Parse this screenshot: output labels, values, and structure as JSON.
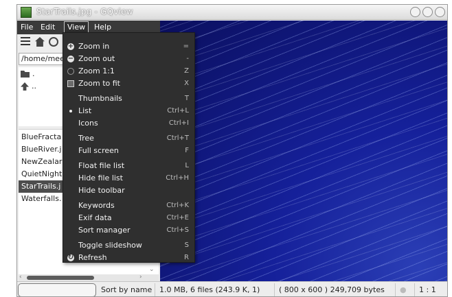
{
  "window": {
    "title": "StarTrails.jpg - GQview"
  },
  "menubar": {
    "file": "File",
    "edit": "Edit",
    "view": "View",
    "help": "Help"
  },
  "sidebar": {
    "path": "/home/mee",
    "dirs": [
      ".",
      ".."
    ],
    "files": [
      "BlueFracta",
      "BlueRiver.j",
      "NewZealar",
      "QuietNight",
      "StarTrails.j",
      "Waterfalls."
    ],
    "selected_index": 4
  },
  "menu": {
    "items": [
      {
        "label": "Zoom in",
        "accel": "=",
        "icon": "zoom-in-icon"
      },
      {
        "label": "Zoom out",
        "accel": "-",
        "icon": "zoom-out-icon"
      },
      {
        "label": "Zoom 1:1",
        "accel": "Z",
        "icon": "zoom-100-icon"
      },
      {
        "label": "Zoom to fit",
        "accel": "X",
        "icon": "zoom-fit-icon"
      },
      {
        "label": "Thumbnails",
        "accel": "T"
      },
      {
        "label": "List",
        "accel": "Ctrl+L",
        "icon": "radio-selected-icon"
      },
      {
        "label": "Icons",
        "accel": "Ctrl+I"
      },
      {
        "label": "Tree",
        "accel": "Ctrl+T"
      },
      {
        "label": "Full screen",
        "accel": "F"
      },
      {
        "label": "Float file list",
        "accel": "L"
      },
      {
        "label": "Hide file list",
        "accel": "Ctrl+H"
      },
      {
        "label": "Hide toolbar",
        "accel": ""
      },
      {
        "label": "Keywords",
        "accel": "Ctrl+K"
      },
      {
        "label": "Exif data",
        "accel": "Ctrl+E"
      },
      {
        "label": "Sort manager",
        "accel": "Ctrl+S"
      },
      {
        "label": "Toggle slideshow",
        "accel": "S"
      },
      {
        "label": "Refresh",
        "accel": "R",
        "icon": "refresh-icon"
      }
    ]
  },
  "status": {
    "sort": "Sort by name",
    "info": "1.0 MB, 6 files (243.9 K, 1)",
    "image": "( 800 x 600 ) 249,709 bytes",
    "zoom": "1 : 1"
  },
  "colors": {
    "menu_bg": "#2f2f2f",
    "selection": "#4d4d4d",
    "image_blue": "#15209a"
  }
}
